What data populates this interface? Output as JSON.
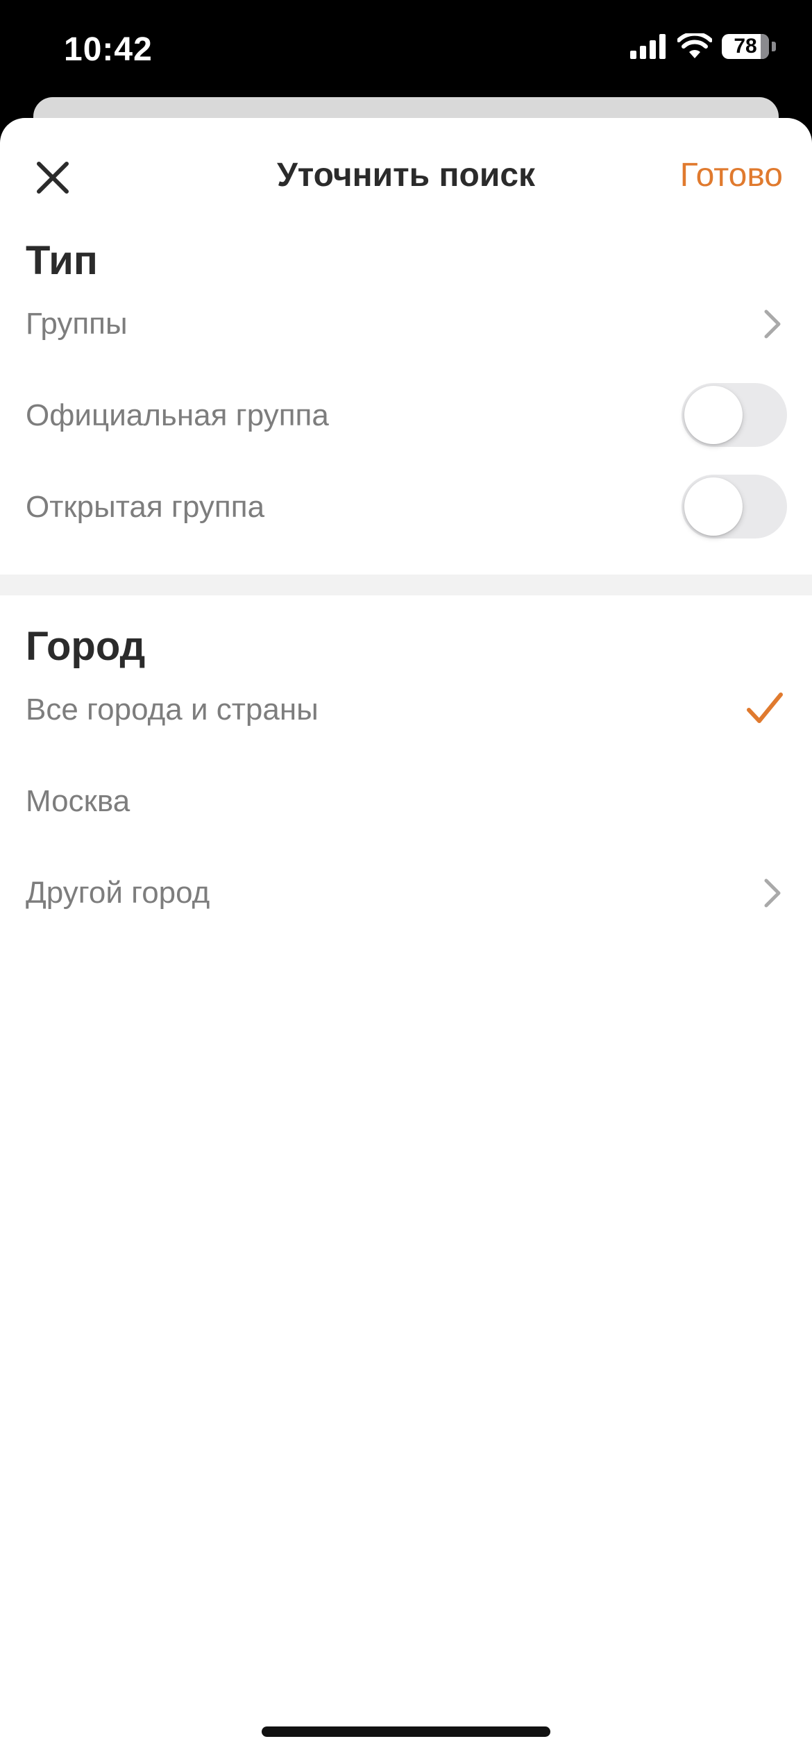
{
  "status_bar": {
    "time": "10:42",
    "battery": "78",
    "icons": [
      "cellular-signal-icon",
      "wifi-icon",
      "battery-icon"
    ]
  },
  "nav": {
    "title": "Уточнить поиск",
    "done_label": "Готово",
    "close_icon": "close-icon"
  },
  "sections": {
    "type": {
      "title": "Тип",
      "groups_label": "Группы",
      "official_label": "Официальная группа",
      "official_on": false,
      "open_label": "Открытая группа",
      "open_on": false
    },
    "city": {
      "title": "Город",
      "all_label": "Все города и страны",
      "all_selected": true,
      "moscow_label": "Москва",
      "other_label": "Другой город"
    }
  },
  "colors": {
    "accent": "#e07a2e",
    "text_primary": "#2b2b2b",
    "text_secondary": "#7d7d7d",
    "toggle_off": "#e9e9eb",
    "separator_band": "#f2f2f2"
  }
}
